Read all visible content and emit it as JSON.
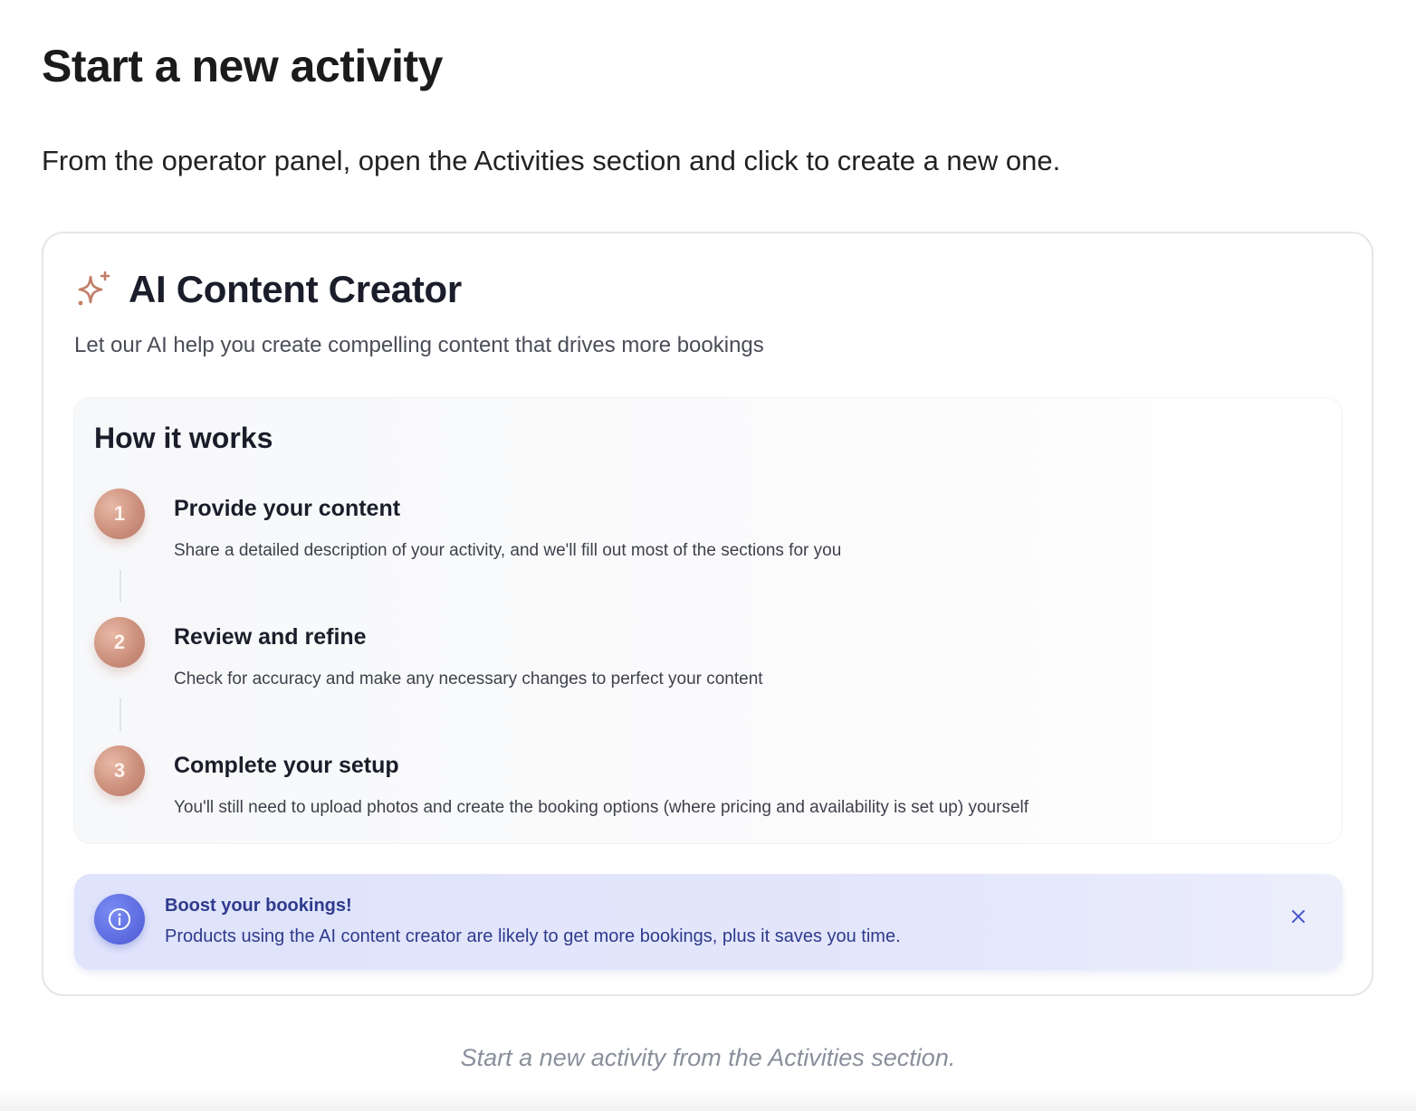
{
  "page": {
    "title": "Start a new activity",
    "intro": "From the operator panel, open the Activities section and click to create a new one.",
    "caption": "Start a new activity from the Activities section."
  },
  "card": {
    "icon": "sparkle-icon",
    "title": "AI Content Creator",
    "subtitle": "Let our AI help you create compelling content that drives more bookings",
    "how_it_works": {
      "title": "How it works",
      "steps": [
        {
          "number": "1",
          "title": "Provide your content",
          "description": "Share a detailed description of your activity, and we'll fill out most of the sections for you"
        },
        {
          "number": "2",
          "title": "Review and refine",
          "description": "Check for accuracy and make any necessary changes to perfect your content"
        },
        {
          "number": "3",
          "title": "Complete your setup",
          "description": "You'll still need to upload photos and create the booking options (where pricing and availability is set up) yourself"
        }
      ]
    },
    "alert": {
      "icon": "info-icon",
      "title": "Boost your bookings!",
      "text": "Products using the AI content creator are likely to get more bookings, plus it saves you time.",
      "close_icon": "close-icon"
    }
  },
  "colors": {
    "accent_copper": "#c98d79",
    "info_blue": "#5a68de",
    "alert_text": "#2e3a8c",
    "alert_bg": "#e2e5fb"
  }
}
